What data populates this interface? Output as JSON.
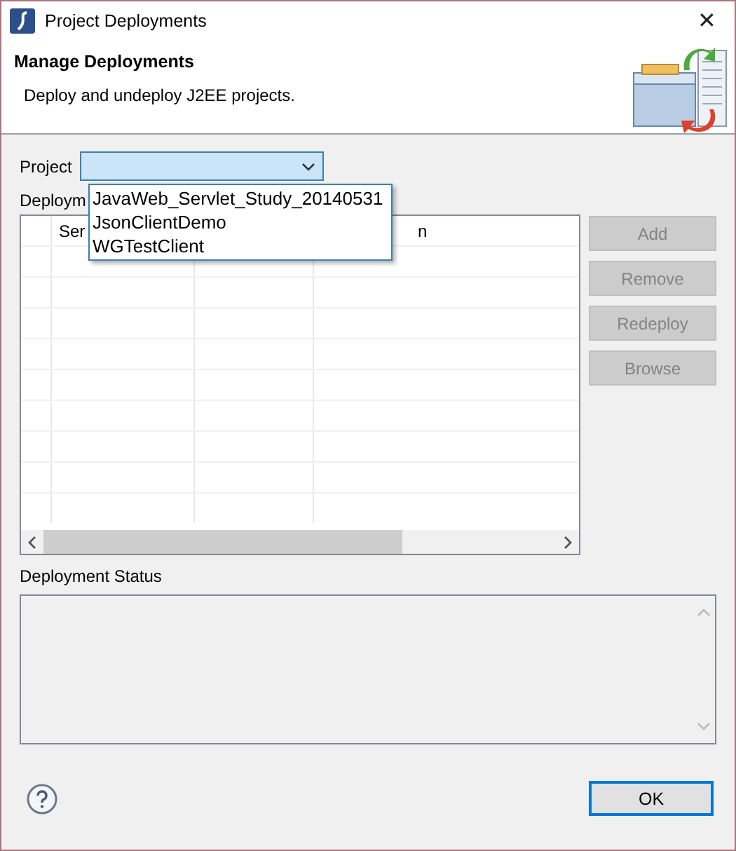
{
  "window": {
    "title": "Project Deployments",
    "close": "✕"
  },
  "header": {
    "title": "Manage Deployments",
    "description": "Deploy and undeploy J2EE projects."
  },
  "project": {
    "label": "Project",
    "expanded": true,
    "options": [
      {
        "label": "JavaWeb_Servlet_Study_20140531",
        "selected": false
      },
      {
        "label": "JsonClientDemo",
        "selected": false
      },
      {
        "label": "WGTestClient",
        "selected": false
      }
    ]
  },
  "deployments": {
    "label": "Deploym",
    "table": {
      "columns": [
        "",
        "Ser",
        "",
        "n"
      ]
    }
  },
  "buttons": [
    {
      "label": "Add",
      "disabled": true
    },
    {
      "label": "Remove",
      "disabled": true
    },
    {
      "label": "Redeploy",
      "disabled": true
    },
    {
      "label": "Browse",
      "disabled": true
    }
  ],
  "status": {
    "label": "Deployment Status"
  },
  "footer": {
    "ok": "OK"
  }
}
